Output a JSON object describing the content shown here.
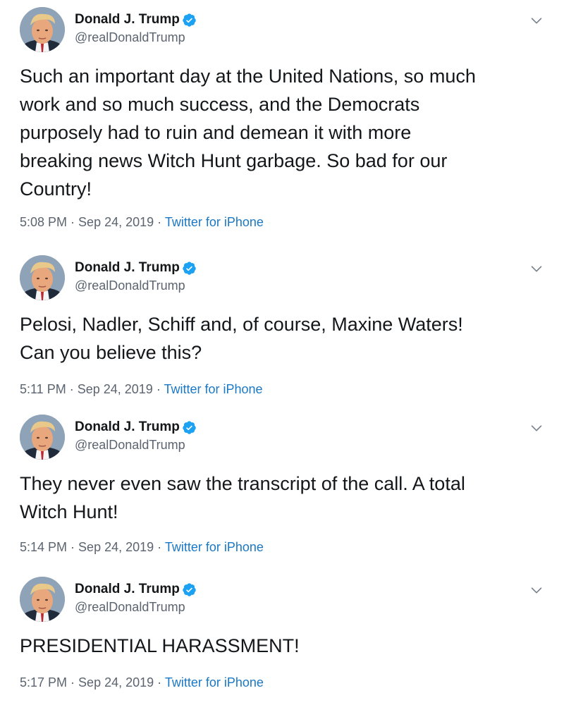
{
  "accent_color": "#1da1f2",
  "tweets": [
    {
      "display_name": "Donald J. Trump",
      "handle": "@realDonaldTrump",
      "verified_icon": "verified-badge-icon",
      "menu_icon": "chevron-down-icon",
      "text": "Such an important day at the United Nations, so much\nwork and so much success, and the Democrats\npurposely had to ruin and demean it with more\nbreaking news Witch Hunt garbage. So bad for our\nCountry!",
      "time": "5:08 PM",
      "sep1": " · ",
      "date": "Sep 24, 2019",
      "sep2": " · ",
      "source": "Twitter for iPhone"
    },
    {
      "display_name": "Donald J. Trump",
      "handle": "@realDonaldTrump",
      "verified_icon": "verified-badge-icon",
      "menu_icon": "chevron-down-icon",
      "text": "Pelosi, Nadler, Schiff and, of course, Maxine Waters!\nCan you believe this?",
      "time": "5:11 PM",
      "sep1": " · ",
      "date": "Sep 24, 2019",
      "sep2": " · ",
      "source": "Twitter for iPhone"
    },
    {
      "display_name": "Donald J. Trump",
      "handle": "@realDonaldTrump",
      "verified_icon": "verified-badge-icon",
      "menu_icon": "chevron-down-icon",
      "text": "They never even saw the transcript of the call. A total\nWitch Hunt!",
      "time": "5:14 PM",
      "sep1": " · ",
      "date": "Sep 24, 2019",
      "sep2": " · ",
      "source": "Twitter for iPhone"
    },
    {
      "display_name": "Donald J. Trump",
      "handle": "@realDonaldTrump",
      "verified_icon": "verified-badge-icon",
      "menu_icon": "chevron-down-icon",
      "text": "PRESIDENTIAL HARASSMENT!",
      "time": "5:17 PM",
      "sep1": " · ",
      "date": "Sep 24, 2019",
      "sep2": " · ",
      "source": "Twitter for iPhone"
    }
  ]
}
